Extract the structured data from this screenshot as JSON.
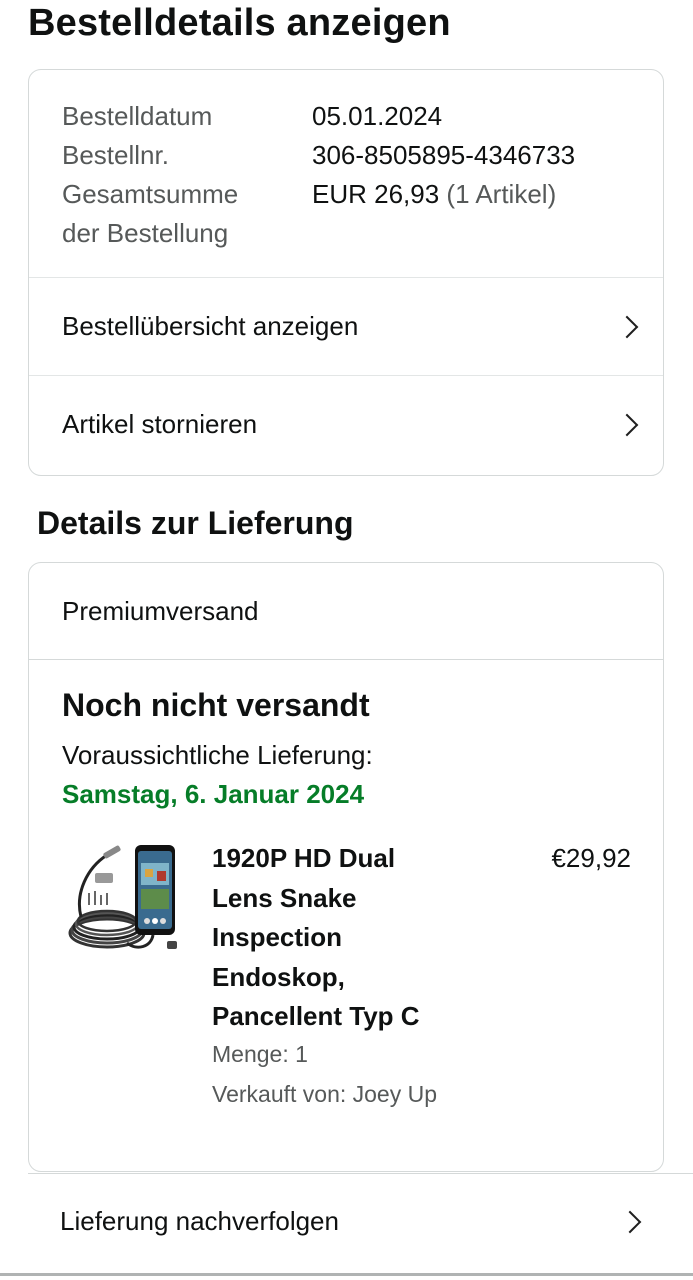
{
  "page": {
    "title": "Bestelldetails anzeigen"
  },
  "summary": {
    "order_date_label": "Bestelldatum",
    "order_date_value": "05.01.2024",
    "order_number_label": "Bestellnr.",
    "order_number_value": "306-8505895-4346733",
    "total_label_line1": "Gesamtsumme",
    "total_label_line2": "der Bestellung",
    "total_value": "EUR 26,93",
    "total_items": "(1 Artikel)",
    "actions": [
      {
        "label": "Bestellübersicht anzeigen",
        "icon": "chevron-right-icon"
      },
      {
        "label": "Artikel stornieren",
        "icon": "chevron-right-icon"
      }
    ]
  },
  "delivery": {
    "section_title": "Details zur Lieferung",
    "shipping_method": "Premiumversand",
    "status": "Noch nicht versandt",
    "eta_label": "Voraussichtliche Lieferung:",
    "eta_date": "Samstag, 6. Januar 2024",
    "eta_color": "#067d28",
    "item": {
      "title_lines": [
        "1920P HD Dual",
        "Lens Snake",
        "Inspection",
        "Endoskop,",
        "Pancellent Typ C"
      ],
      "price": "€29,92",
      "quantity": "Menge: 1",
      "seller": "Verkauft von: Joey Up",
      "image": "endoscope-product-image"
    }
  },
  "track": {
    "label": "Lieferung nachverfolgen",
    "icon": "chevron-right-icon"
  }
}
